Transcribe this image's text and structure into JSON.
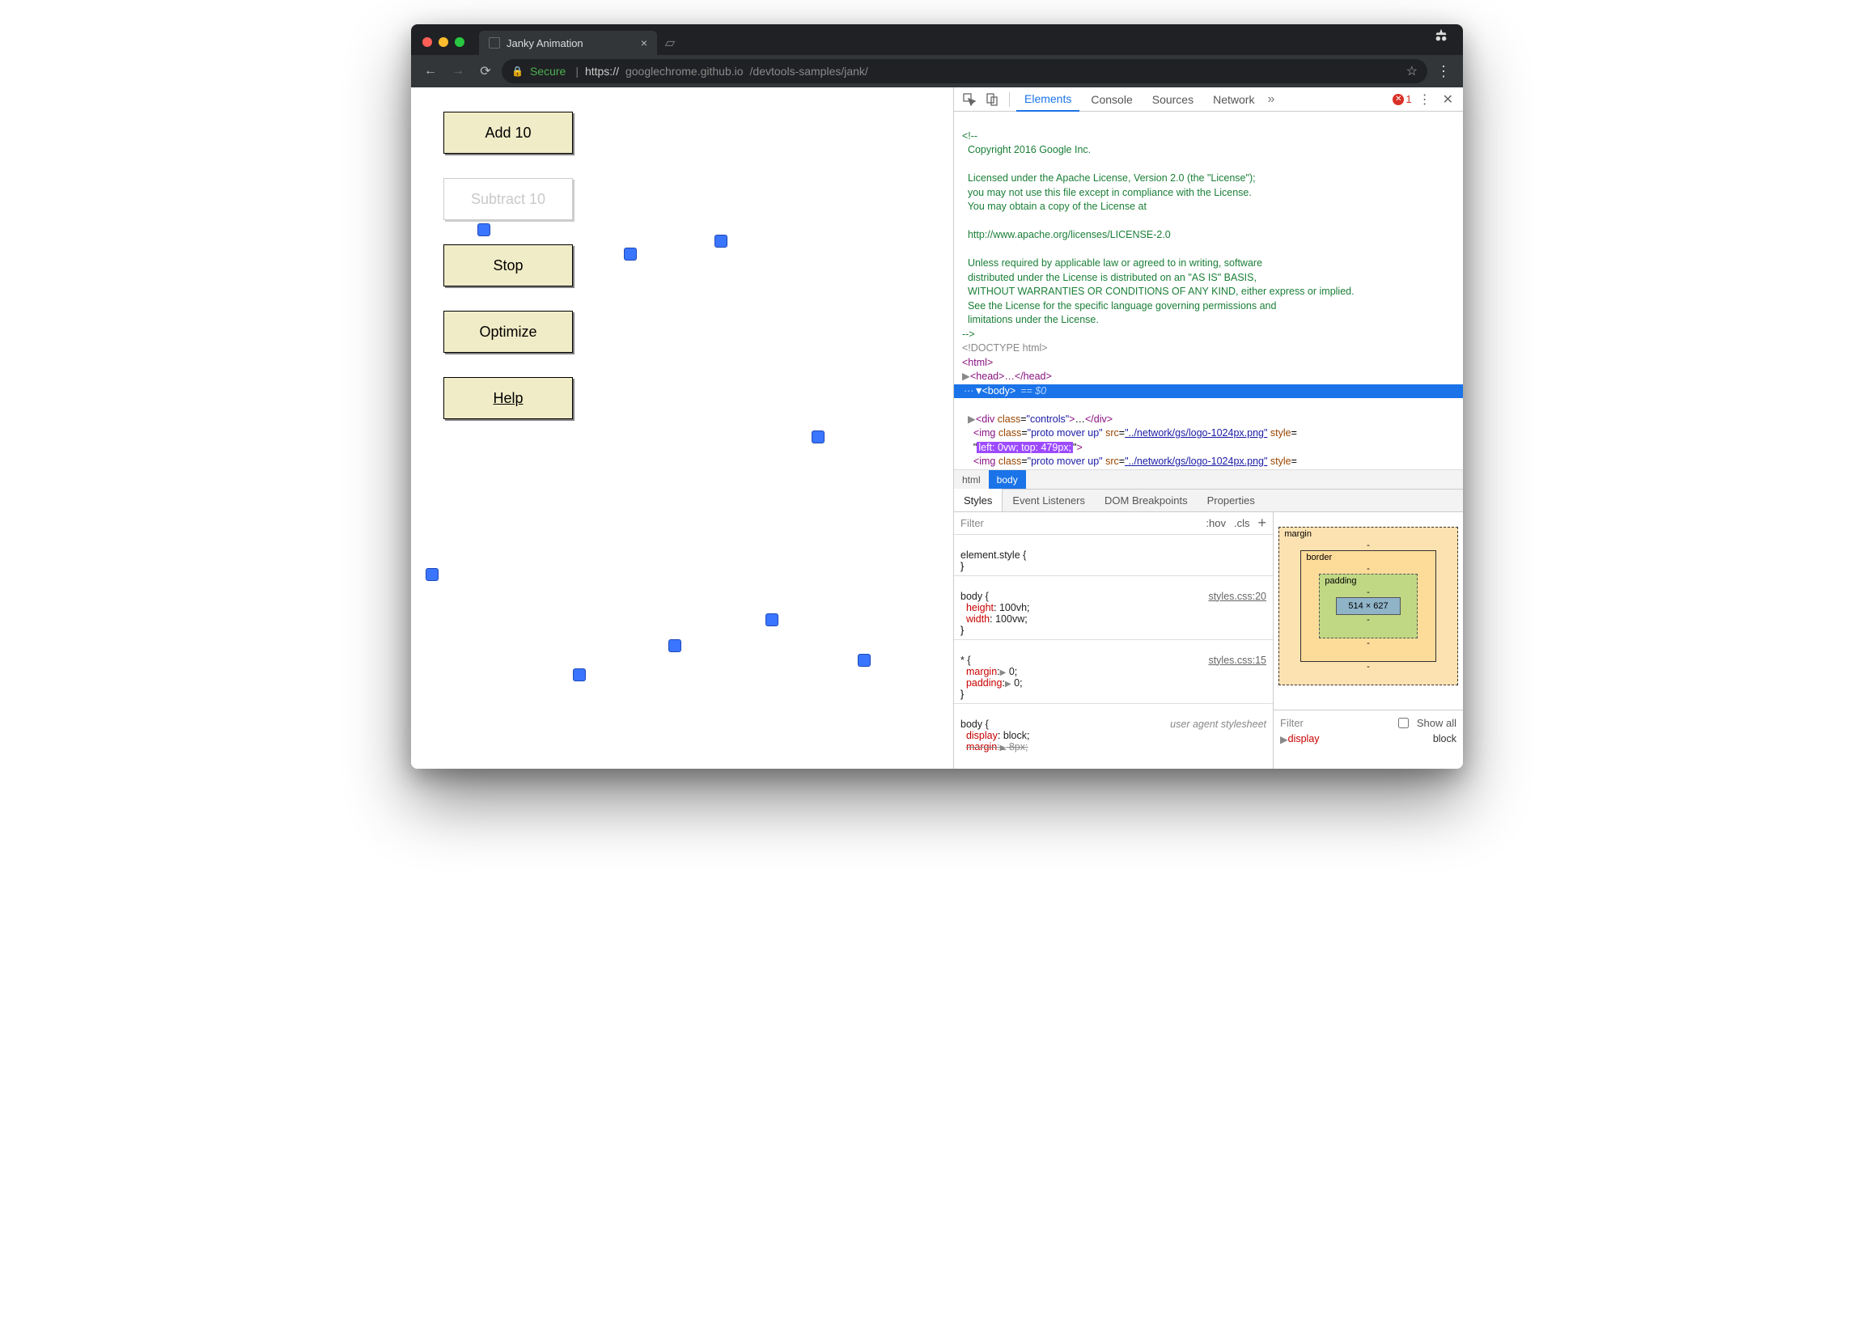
{
  "browser": {
    "tab_title": "Janky Animation",
    "secure_label": "Secure",
    "url_prefix": "https://",
    "url_host": "googlechrome.github.io",
    "url_path": "/devtools-samples/jank/"
  },
  "page": {
    "buttons": {
      "add": "Add 10",
      "subtract": "Subtract 10",
      "stop": "Stop",
      "optimize": "Optimize",
      "help": "Help"
    }
  },
  "devtools": {
    "tabs": {
      "elements": "Elements",
      "console": "Console",
      "sources": "Sources",
      "network": "Network"
    },
    "error_count": "1",
    "comment_lines": [
      "<!--",
      "  Copyright 2016 Google Inc.",
      "",
      "  Licensed under the Apache License, Version 2.0 (the \"License\");",
      "  you may not use this file except in compliance with the License.",
      "  You may obtain a copy of the License at",
      "",
      "  http://www.apache.org/licenses/LICENSE-2.0",
      "",
      "  Unless required by applicable law or agreed to in writing, software",
      "  distributed under the License is distributed on an \"AS IS\" BASIS,",
      "  WITHOUT WARRANTIES OR CONDITIONS OF ANY KIND, either express or implied.",
      "  See the License for the specific language governing permissions and",
      "  limitations under the License.",
      "-->"
    ],
    "doctype": "<!DOCTYPE html>",
    "html_tag": "<html>",
    "head_collapsed": "<head>…</head>",
    "body_tag": "<body>",
    "body_suffix": "== $0",
    "div_controls_open": "<div class=\"controls\">",
    "div_controls_close": "…</div>",
    "img_class": "proto mover up",
    "img_src": "../network/gs/logo-1024px.png",
    "img_style_highlight": "left: 0vw; top: 479px;",
    "crumbs": {
      "html": "html",
      "body": "body"
    },
    "subtabs": {
      "styles": "Styles",
      "listeners": "Event Listeners",
      "dom": "DOM Breakpoints",
      "props": "Properties"
    },
    "filter_placeholder": "Filter",
    "hov": ":hov",
    "cls": ".cls",
    "rules": {
      "element_style": "element.style {",
      "body_sel": "body {",
      "height": "height",
      "h_val": "100vh",
      "width": "width",
      "w_val": "100vw",
      "star_sel": "* {",
      "margin": "margin",
      "m_val": "0",
      "padding": "padding",
      "p_val": "0",
      "display": "display",
      "d_val": "block",
      "margin2": "margin",
      "m2_val": "8px",
      "link1": "styles.css:20",
      "link2": "styles.css:15",
      "ua": "user agent stylesheet"
    },
    "boxmodel": {
      "margin": "margin",
      "border": "border",
      "padding": "padding",
      "dash": "-",
      "content": "514 × 627"
    },
    "computed": {
      "filter": "Filter",
      "showall": "Show all",
      "display_p": "display",
      "display_v": "block"
    }
  }
}
